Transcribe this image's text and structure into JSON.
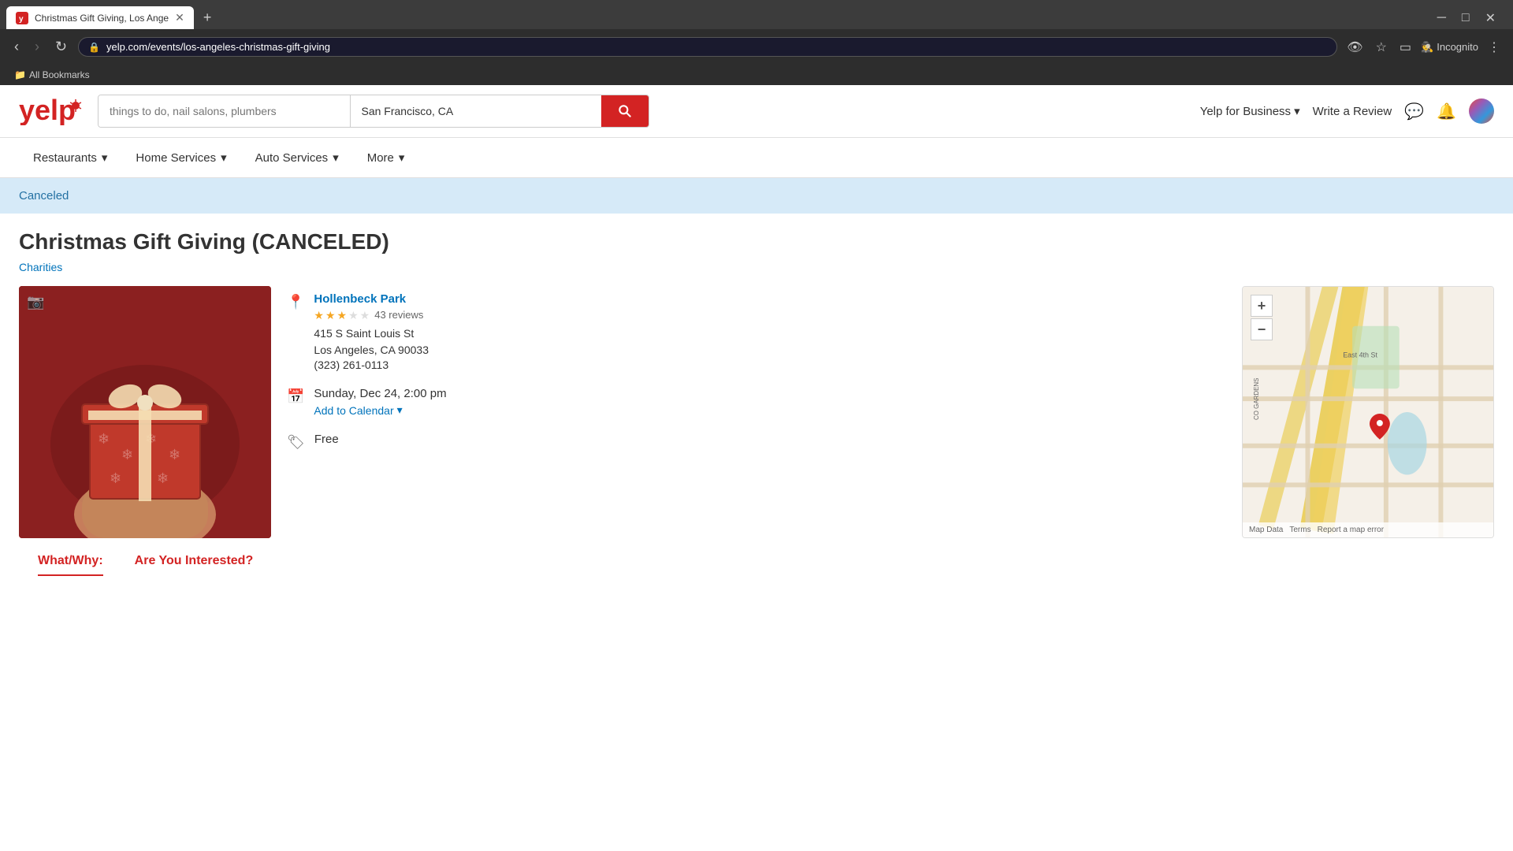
{
  "browser": {
    "tab_title": "Christmas Gift Giving, Los Ange",
    "url": "yelp.com/events/los-angeles-christmas-gift-giving",
    "incognito_label": "Incognito",
    "bookmarks_label": "All Bookmarks"
  },
  "yelp": {
    "logo_alt": "Yelp",
    "search": {
      "what_placeholder": "things to do, nail salons, plumbers",
      "where_value": "San Francisco, CA"
    },
    "header": {
      "for_business": "Yelp for Business",
      "write_review": "Write a Review"
    },
    "nav": {
      "items": [
        {
          "label": "Restaurants",
          "has_dropdown": true
        },
        {
          "label": "Home Services",
          "has_dropdown": true
        },
        {
          "label": "Auto Services",
          "has_dropdown": true
        },
        {
          "label": "More",
          "has_dropdown": true
        }
      ]
    }
  },
  "event": {
    "status_banner": "Canceled",
    "title": "Christmas Gift Giving (CANCELED)",
    "category": "Charities",
    "venue": {
      "name": "Hollenbeck Park",
      "stars": 3,
      "max_stars": 5,
      "reviews": "43 reviews",
      "address_line1": "415 S Saint Louis St",
      "address_line2": "Los Angeles, CA 90033",
      "phone": "(323) 261-0113"
    },
    "date": "Sunday, Dec 24, 2:00 pm",
    "add_to_calendar": "Add to Calendar",
    "price": "Free",
    "sections": {
      "what_why_label": "What/Why:",
      "are_you_interested_label": "Are You Interested?"
    }
  },
  "map": {
    "zoom_in": "+",
    "zoom_out": "−",
    "footer_items": [
      "Map Data",
      "Terms",
      "Report a map error"
    ]
  }
}
